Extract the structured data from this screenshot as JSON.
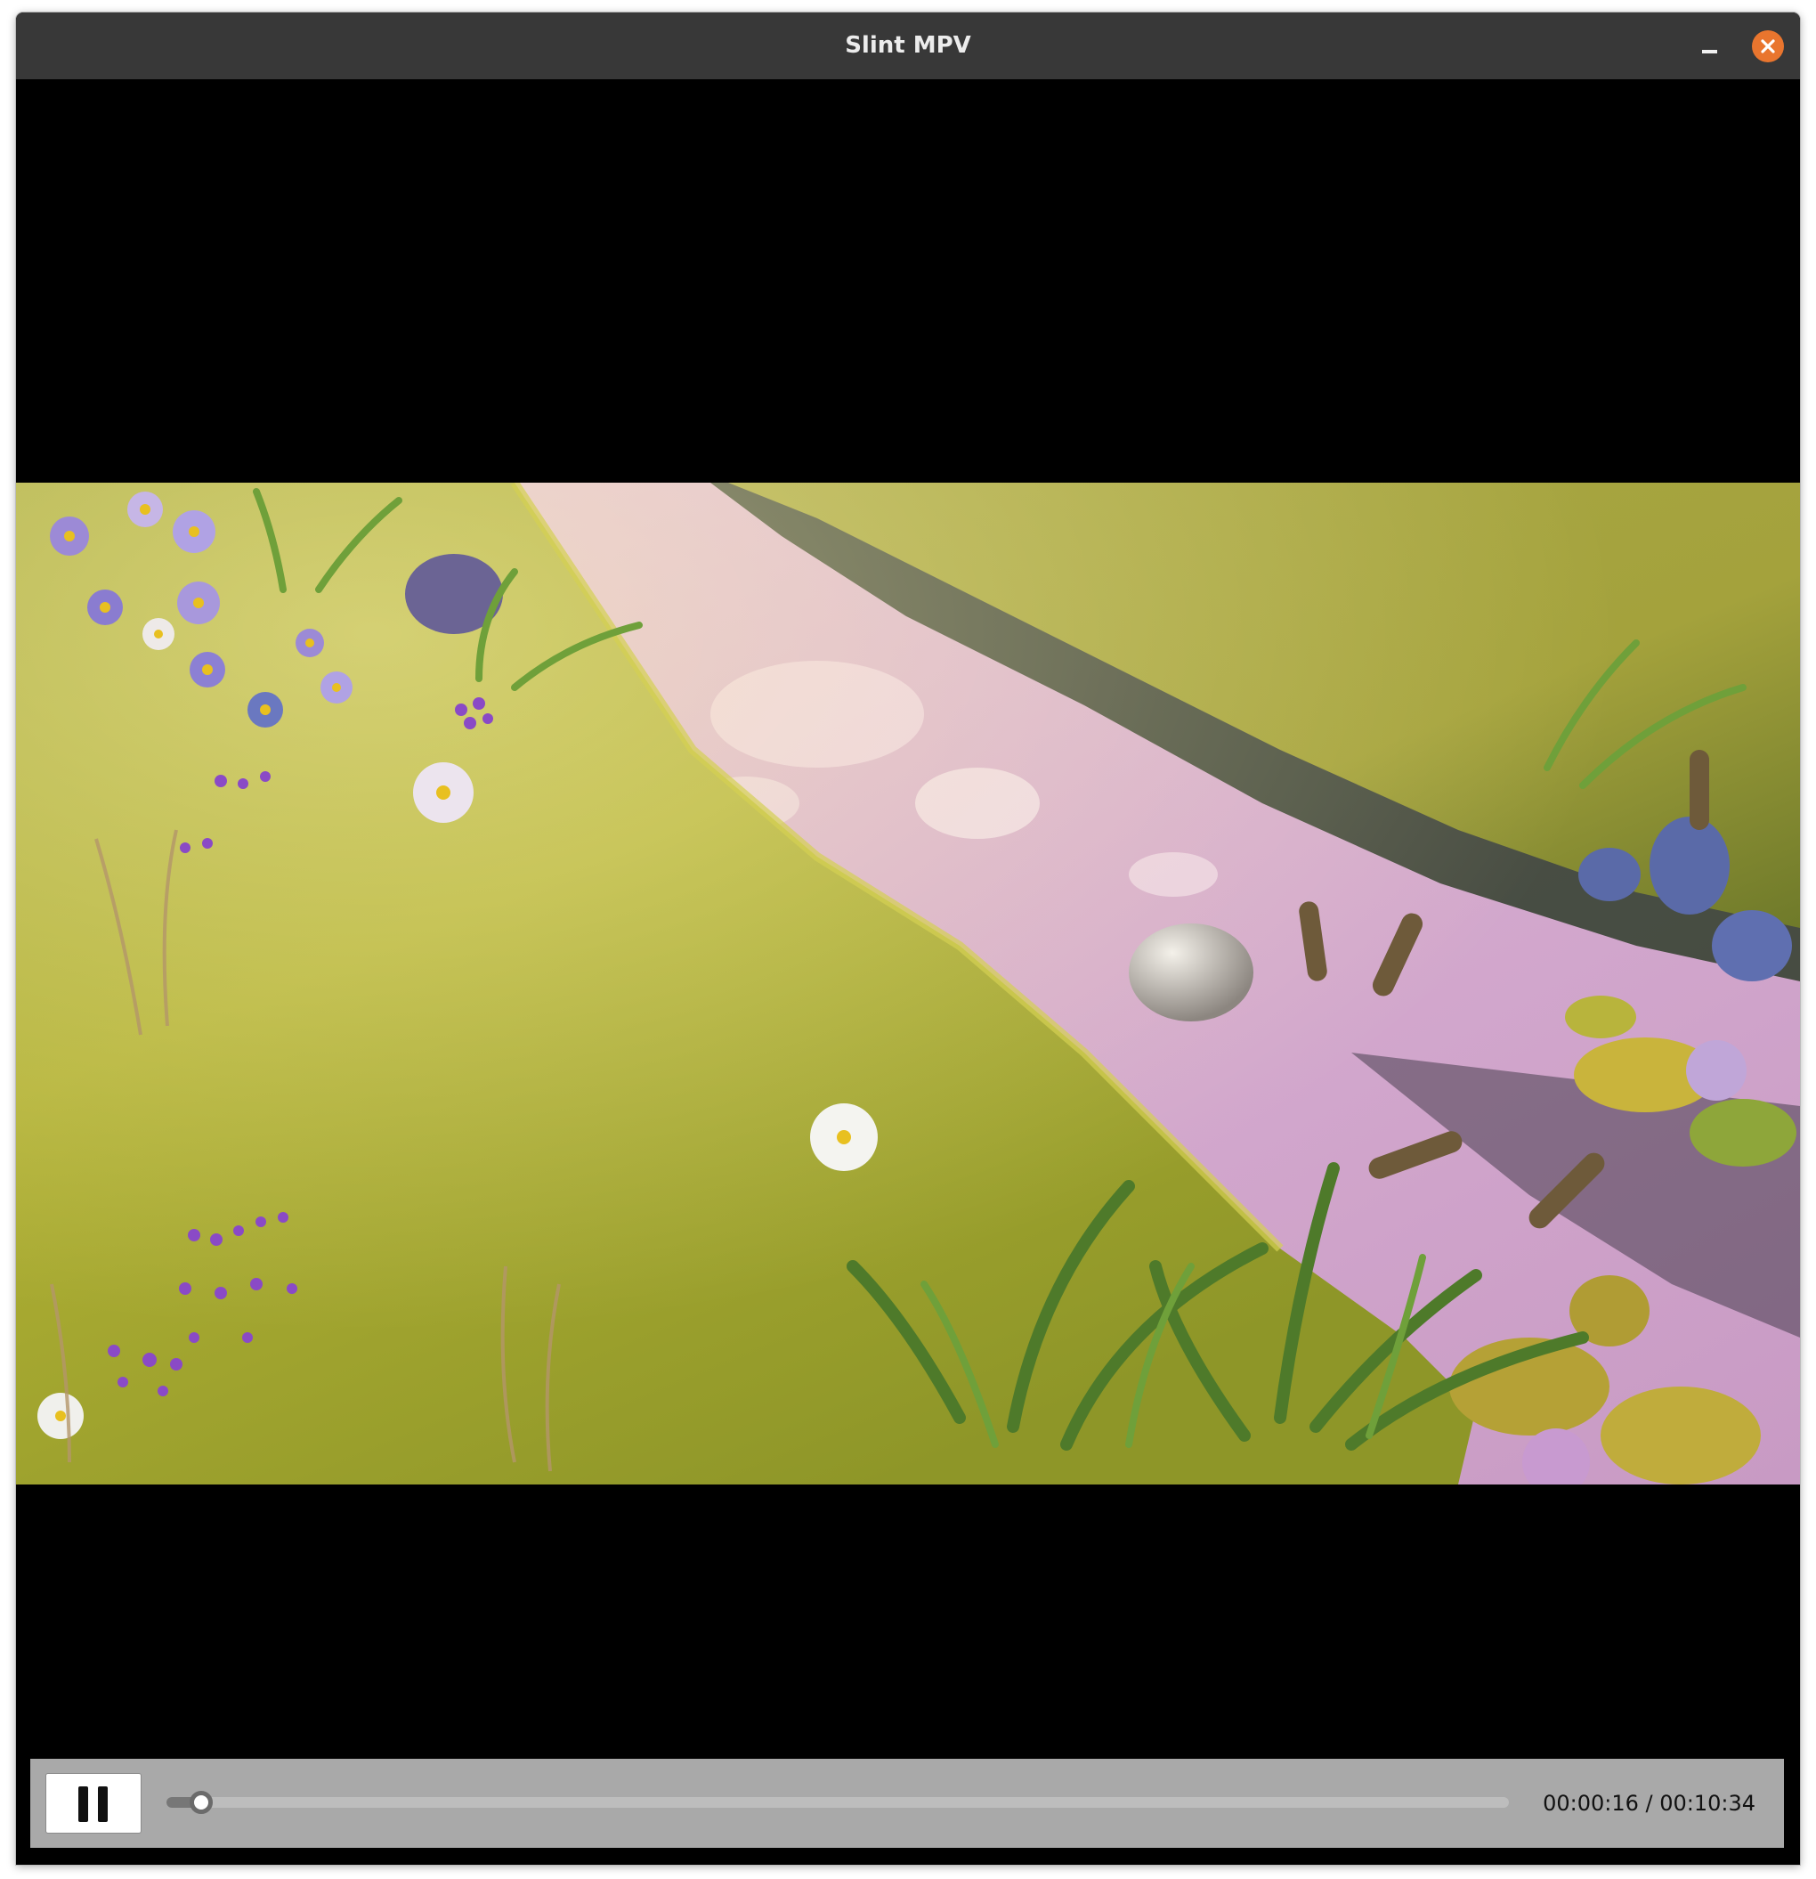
{
  "window": {
    "title": "Slint MPV",
    "minimize_icon": "minimize-icon",
    "close_icon": "close-icon",
    "close_color": "#e9752e"
  },
  "video": {
    "content": "animated meadow scene with a pink-reflecting stream, grass, flowers, rocks and cattails"
  },
  "controls": {
    "play_state": "playing",
    "pause_icon": "pause-icon",
    "position": "00:00:16",
    "duration": "00:10:34",
    "time_label": "00:00:16 / 00:10:34",
    "progress_fraction": 0.0252
  },
  "colors": {
    "titlebar": "#383838",
    "controls_bg": "#a9a9a9",
    "close_button": "#e9752e"
  }
}
